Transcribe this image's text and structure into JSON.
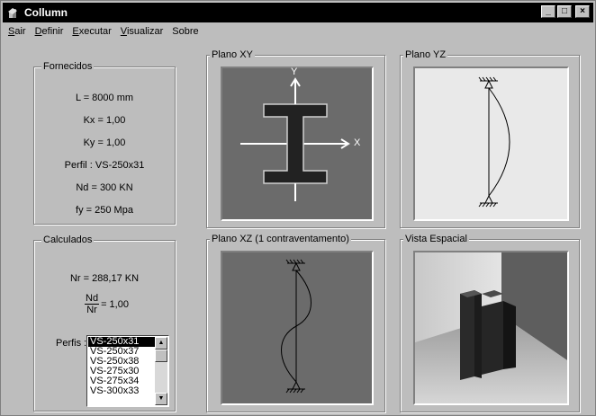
{
  "window": {
    "title": "Collumn",
    "minimize_glyph": "_",
    "maximize_glyph": "□",
    "close_glyph": "×"
  },
  "menu": {
    "items": [
      {
        "accel": "S",
        "rest": "air"
      },
      {
        "accel": "D",
        "rest": "efinir"
      },
      {
        "accel": "E",
        "rest": "xecutar"
      },
      {
        "accel": "V",
        "rest": "isualizar"
      },
      {
        "accel": "",
        "rest": "Sobre"
      }
    ]
  },
  "fornecidos": {
    "title": "Fornecidos",
    "L": "L = 8000 mm",
    "Kx": "Kx = 1,00",
    "Ky": "Ky = 1,00",
    "perfil": "Perfil : VS-250x31",
    "Nd": "Nd = 300 KN",
    "fy": "fy = 250 Mpa"
  },
  "calculados": {
    "title": "Calculados",
    "Nr": "Nr = 288,17 KN",
    "ratio_num": "Nd",
    "ratio_den": "Nr",
    "ratio_val": "= 1,00",
    "perfis_label": "Perfis :",
    "perfis": [
      "VS-250x31",
      "VS-250x37",
      "VS-250x38",
      "VS-275x30",
      "VS-275x34",
      "VS-300x33"
    ],
    "selected_index": 0
  },
  "views": {
    "xy": {
      "title": "Plano XY",
      "x_label": "X",
      "y_label": "Y"
    },
    "yz": {
      "title": "Plano YZ"
    },
    "xz": {
      "title": "Plano XZ (1 contraventamento)"
    },
    "spatial": {
      "title": "Vista Espacial"
    }
  },
  "colors": {
    "window_bg": "#bdbdbd",
    "titlebar": "#000000",
    "view_dark_bg": "#6b6b6b",
    "view_light_bg": "#e9e9e9"
  }
}
